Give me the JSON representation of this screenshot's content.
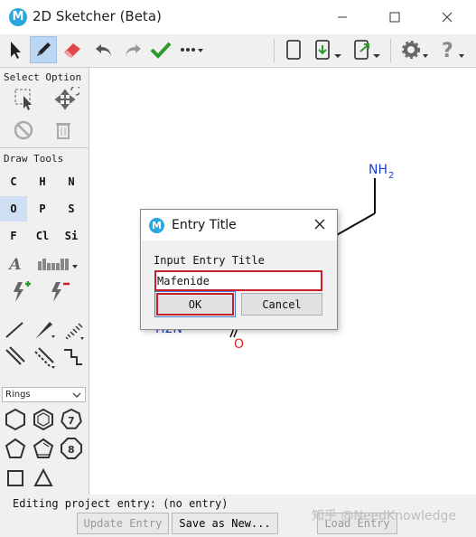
{
  "window": {
    "title": "2D Sketcher (Beta)",
    "logo_letter": "M"
  },
  "panel": {
    "select_title": "Select Option",
    "draw_title": "Draw Tools",
    "elements": [
      "C",
      "H",
      "N",
      "O",
      "P",
      "S",
      "F",
      "Cl",
      "Si"
    ],
    "text_tool_letter": "A",
    "ring_sizes": [
      "7",
      "8"
    ],
    "rings_label": "Rings"
  },
  "molecule": {
    "label_nh2_main": "NH",
    "label_nh2_sub": "2",
    "label_oxygen": "O",
    "label_h2n": "H2N"
  },
  "dialog": {
    "logo_letter": "M",
    "title": "Entry Title",
    "prompt": "Input Entry Title",
    "input_value": "Mafenide",
    "ok_label": "OK",
    "cancel_label": "Cancel"
  },
  "status": {
    "text": "Editing project entry: (no entry)"
  },
  "buttons": {
    "update": "Update Entry",
    "save_new": "Save as New...",
    "load": "Load Entry"
  },
  "watermark": "知乎 @NeedKnowledge",
  "colors": {
    "accent_blue": "#2aa8de",
    "highlight_red": "#c8202b",
    "atom_blue": "#1a3fc4",
    "atom_red": "#e02020",
    "check_green": "#2e9a2e"
  }
}
